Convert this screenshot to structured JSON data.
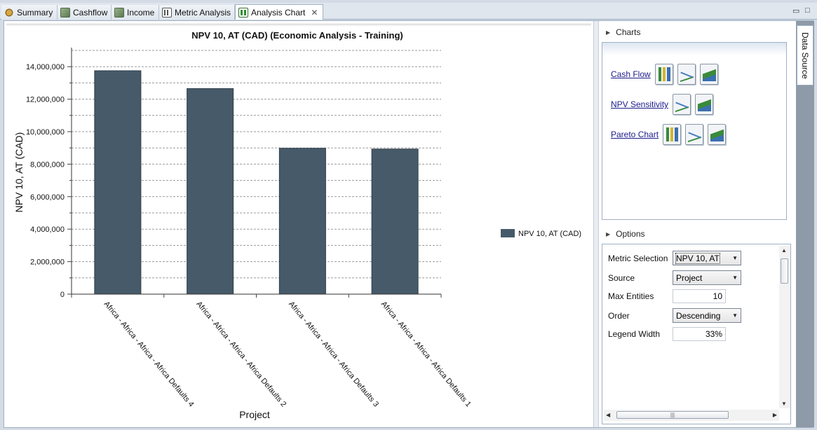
{
  "tabs": [
    {
      "label": "Summary",
      "icon": "summary-icon"
    },
    {
      "label": "Cashflow",
      "icon": "cashflow-icon"
    },
    {
      "label": "Income",
      "icon": "income-icon"
    },
    {
      "label": "Metric Analysis",
      "icon": "metric-analysis-icon"
    },
    {
      "label": "Analysis Chart",
      "icon": "analysis-chart-icon",
      "active": true
    }
  ],
  "chart_data": {
    "type": "bar",
    "title": "NPV 10, AT (CAD) (Economic Analysis - Training)",
    "xlabel": "Project",
    "ylabel": "NPV 10, AT (CAD)",
    "categories": [
      "Africa - Africa - Africa - Africa Defaults 4",
      "Africa - Africa - Africa - Africa Defaults 2",
      "Africa - Africa - Africa - Africa Defaults 3",
      "Africa - Africa - Africa - Africa Defaults 1"
    ],
    "series": [
      {
        "name": "NPV 10, AT (CAD)",
        "values": [
          13750000,
          12650000,
          8980000,
          8930000
        ],
        "color": "#465a69"
      }
    ],
    "ylim": [
      0,
      15000000
    ],
    "yticks": [
      0,
      2000000,
      4000000,
      6000000,
      8000000,
      10000000,
      12000000,
      14000000
    ],
    "ytick_labels": [
      "0",
      "2,000,000",
      "4,000,000",
      "6,000,000",
      "8,000,000",
      "10,000,000",
      "12,000,000",
      "14,000,000"
    ],
    "grid": true,
    "legend_position": "right"
  },
  "charts_panel": {
    "title": "Charts",
    "links": [
      {
        "label": "Cash Flow",
        "icons": [
          "bar-chart-icon",
          "line-chart-icon",
          "area-chart-icon"
        ]
      },
      {
        "label": "NPV Sensitivity",
        "icons": [
          "line-chart-icon",
          "area-chart-icon"
        ]
      },
      {
        "label": "Pareto Chart",
        "icons": [
          "bar-chart-icon",
          "line-chart-icon",
          "area-chart-icon"
        ]
      }
    ]
  },
  "options_panel": {
    "title": "Options",
    "metric_selection_label": "Metric Selection",
    "metric_selection_value": "NPV 10, AT",
    "source_label": "Source",
    "source_value": "Project",
    "max_entities_label": "Max Entities",
    "max_entities_value": "10",
    "order_label": "Order",
    "order_value": "Descending",
    "legend_width_label": "Legend Width",
    "legend_width_value": "33%"
  },
  "side_tab": {
    "label": "Data Source"
  },
  "window_controls": {
    "minimize": "▭",
    "maximize": "□"
  }
}
